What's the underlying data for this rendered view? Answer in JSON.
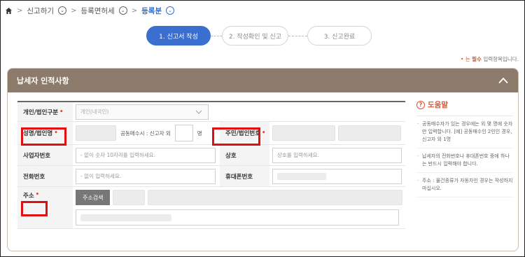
{
  "breadcrumb": {
    "items": [
      "신고하기",
      "등록면허세",
      "등록분"
    ]
  },
  "steps": [
    "1. 신고서 작성",
    "2. 작성확인 및 신고",
    "3. 신고완료"
  ],
  "required_note": {
    "prefix": "• 는",
    "em": "필수",
    "suffix": "입력항목입니다."
  },
  "section": {
    "title": "납세자 인적사항"
  },
  "form": {
    "type_label": "개인/법인구분",
    "type_value": "개인(내국인)",
    "name_label": "성명/법인명",
    "co_owner_text": "공동매수시 : 신고자 외",
    "co_owner_unit": "명",
    "idnum_label": "주민/법인번호",
    "bizno_label": "사업자번호",
    "bizno_placeholder": "- 없이 숫자 10자리를 입력하세요.",
    "trade_label": "상호",
    "trade_placeholder": "상호를 입력하세요.",
    "phone_label": "전화번호",
    "phone_placeholder": "- 없이 입력하세요.",
    "mobile_label": "휴대폰번호",
    "address_label": "주소",
    "address_button": "주소검색"
  },
  "help": {
    "title": "도움말",
    "items": [
      "공동매수자가 있는 경우에는 외 몇 명에 숫자만 입력합니다. [예] 공동매수인 2인인 경우, 신고자 외 1명",
      "납세자의 전화번호나 휴대폰번호 중에 하나는 반드시 입력해야 합니다.",
      "주소 : 물건종류가 자동차인 경우는 작성하지 마십시오."
    ]
  },
  "colors": {
    "accent": "#3a6fd0",
    "panel_header": "#8c7b6a",
    "required": "#e04a1a",
    "highlight": "#e01010"
  }
}
